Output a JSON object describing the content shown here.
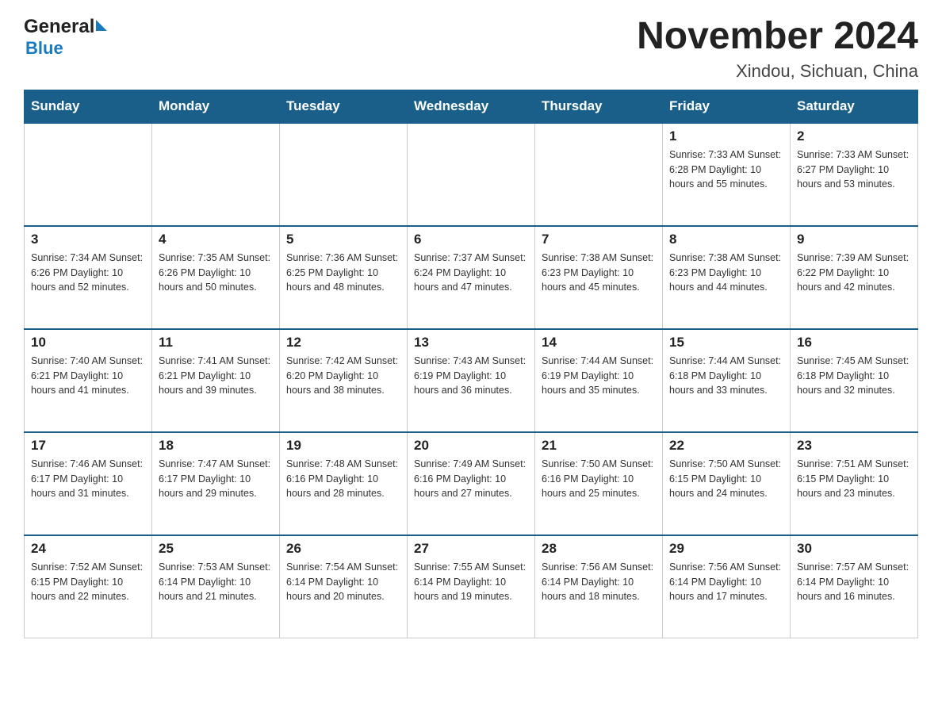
{
  "logo": {
    "text_general": "General",
    "text_blue": "Blue",
    "triangle_desc": "blue triangle icon"
  },
  "header": {
    "title": "November 2024",
    "subtitle": "Xindou, Sichuan, China"
  },
  "weekdays": [
    "Sunday",
    "Monday",
    "Tuesday",
    "Wednesday",
    "Thursday",
    "Friday",
    "Saturday"
  ],
  "weeks": [
    [
      {
        "day": "",
        "info": ""
      },
      {
        "day": "",
        "info": ""
      },
      {
        "day": "",
        "info": ""
      },
      {
        "day": "",
        "info": ""
      },
      {
        "day": "",
        "info": ""
      },
      {
        "day": "1",
        "info": "Sunrise: 7:33 AM\nSunset: 6:28 PM\nDaylight: 10 hours\nand 55 minutes."
      },
      {
        "day": "2",
        "info": "Sunrise: 7:33 AM\nSunset: 6:27 PM\nDaylight: 10 hours\nand 53 minutes."
      }
    ],
    [
      {
        "day": "3",
        "info": "Sunrise: 7:34 AM\nSunset: 6:26 PM\nDaylight: 10 hours\nand 52 minutes."
      },
      {
        "day": "4",
        "info": "Sunrise: 7:35 AM\nSunset: 6:26 PM\nDaylight: 10 hours\nand 50 minutes."
      },
      {
        "day": "5",
        "info": "Sunrise: 7:36 AM\nSunset: 6:25 PM\nDaylight: 10 hours\nand 48 minutes."
      },
      {
        "day": "6",
        "info": "Sunrise: 7:37 AM\nSunset: 6:24 PM\nDaylight: 10 hours\nand 47 minutes."
      },
      {
        "day": "7",
        "info": "Sunrise: 7:38 AM\nSunset: 6:23 PM\nDaylight: 10 hours\nand 45 minutes."
      },
      {
        "day": "8",
        "info": "Sunrise: 7:38 AM\nSunset: 6:23 PM\nDaylight: 10 hours\nand 44 minutes."
      },
      {
        "day": "9",
        "info": "Sunrise: 7:39 AM\nSunset: 6:22 PM\nDaylight: 10 hours\nand 42 minutes."
      }
    ],
    [
      {
        "day": "10",
        "info": "Sunrise: 7:40 AM\nSunset: 6:21 PM\nDaylight: 10 hours\nand 41 minutes."
      },
      {
        "day": "11",
        "info": "Sunrise: 7:41 AM\nSunset: 6:21 PM\nDaylight: 10 hours\nand 39 minutes."
      },
      {
        "day": "12",
        "info": "Sunrise: 7:42 AM\nSunset: 6:20 PM\nDaylight: 10 hours\nand 38 minutes."
      },
      {
        "day": "13",
        "info": "Sunrise: 7:43 AM\nSunset: 6:19 PM\nDaylight: 10 hours\nand 36 minutes."
      },
      {
        "day": "14",
        "info": "Sunrise: 7:44 AM\nSunset: 6:19 PM\nDaylight: 10 hours\nand 35 minutes."
      },
      {
        "day": "15",
        "info": "Sunrise: 7:44 AM\nSunset: 6:18 PM\nDaylight: 10 hours\nand 33 minutes."
      },
      {
        "day": "16",
        "info": "Sunrise: 7:45 AM\nSunset: 6:18 PM\nDaylight: 10 hours\nand 32 minutes."
      }
    ],
    [
      {
        "day": "17",
        "info": "Sunrise: 7:46 AM\nSunset: 6:17 PM\nDaylight: 10 hours\nand 31 minutes."
      },
      {
        "day": "18",
        "info": "Sunrise: 7:47 AM\nSunset: 6:17 PM\nDaylight: 10 hours\nand 29 minutes."
      },
      {
        "day": "19",
        "info": "Sunrise: 7:48 AM\nSunset: 6:16 PM\nDaylight: 10 hours\nand 28 minutes."
      },
      {
        "day": "20",
        "info": "Sunrise: 7:49 AM\nSunset: 6:16 PM\nDaylight: 10 hours\nand 27 minutes."
      },
      {
        "day": "21",
        "info": "Sunrise: 7:50 AM\nSunset: 6:16 PM\nDaylight: 10 hours\nand 25 minutes."
      },
      {
        "day": "22",
        "info": "Sunrise: 7:50 AM\nSunset: 6:15 PM\nDaylight: 10 hours\nand 24 minutes."
      },
      {
        "day": "23",
        "info": "Sunrise: 7:51 AM\nSunset: 6:15 PM\nDaylight: 10 hours\nand 23 minutes."
      }
    ],
    [
      {
        "day": "24",
        "info": "Sunrise: 7:52 AM\nSunset: 6:15 PM\nDaylight: 10 hours\nand 22 minutes."
      },
      {
        "day": "25",
        "info": "Sunrise: 7:53 AM\nSunset: 6:14 PM\nDaylight: 10 hours\nand 21 minutes."
      },
      {
        "day": "26",
        "info": "Sunrise: 7:54 AM\nSunset: 6:14 PM\nDaylight: 10 hours\nand 20 minutes."
      },
      {
        "day": "27",
        "info": "Sunrise: 7:55 AM\nSunset: 6:14 PM\nDaylight: 10 hours\nand 19 minutes."
      },
      {
        "day": "28",
        "info": "Sunrise: 7:56 AM\nSunset: 6:14 PM\nDaylight: 10 hours\nand 18 minutes."
      },
      {
        "day": "29",
        "info": "Sunrise: 7:56 AM\nSunset: 6:14 PM\nDaylight: 10 hours\nand 17 minutes."
      },
      {
        "day": "30",
        "info": "Sunrise: 7:57 AM\nSunset: 6:14 PM\nDaylight: 10 hours\nand 16 minutes."
      }
    ]
  ]
}
